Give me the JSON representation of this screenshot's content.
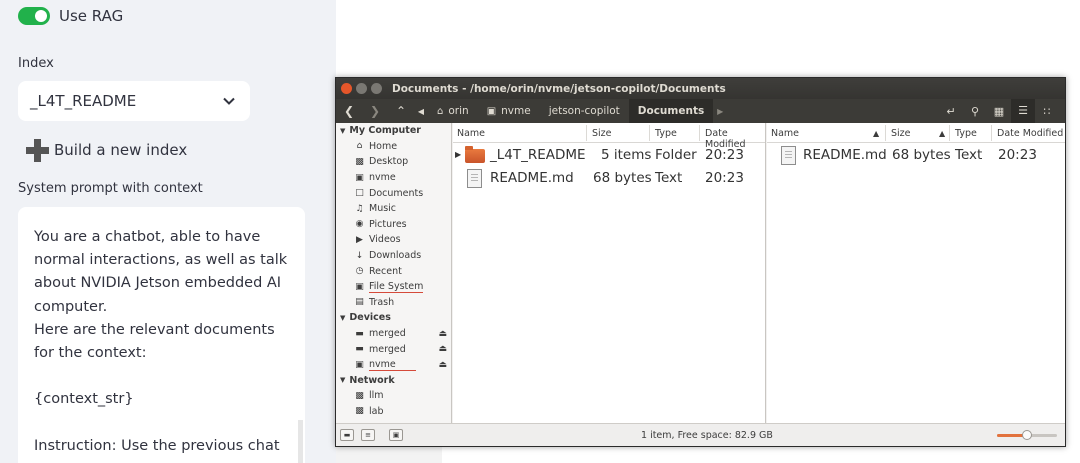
{
  "sidebar": {
    "rag_toggle": {
      "label": "Use RAG",
      "on": true
    },
    "index_label": "Index",
    "index_value": "_L4T_README",
    "build_button": "Build a new index",
    "system_prompt_label": "System prompt with context",
    "system_prompt_text": "You are a chatbot, able to have normal interactions, as well as talk about NVIDIA Jetson embedded AI computer.\nHere are the relevant documents for the context:\n\n{context_str}\n\nInstruction: Use the previous chat"
  },
  "window": {
    "title": "Documents - /home/orin/nvme/jetson-copilot/Documents",
    "breadcrumbs": [
      "orin",
      "nvme",
      "jetson-copilot",
      "Documents"
    ],
    "places": {
      "my_computer": "My Computer",
      "my_computer_items": [
        {
          "label": "Home",
          "icon": "home-icon"
        },
        {
          "label": "Desktop",
          "icon": "desktop-icon"
        },
        {
          "label": "nvme",
          "icon": "drive-icon"
        },
        {
          "label": "Documents",
          "icon": "documents-icon"
        },
        {
          "label": "Music",
          "icon": "music-icon"
        },
        {
          "label": "Pictures",
          "icon": "pictures-icon"
        },
        {
          "label": "Videos",
          "icon": "videos-icon"
        },
        {
          "label": "Downloads",
          "icon": "downloads-icon"
        },
        {
          "label": "Recent",
          "icon": "recent-icon"
        },
        {
          "label": "File System",
          "icon": "filesystem-icon"
        },
        {
          "label": "Trash",
          "icon": "trash-icon"
        }
      ],
      "devices": "Devices",
      "devices_items": [
        {
          "label": "merged",
          "icon": "drive-icon"
        },
        {
          "label": "merged",
          "icon": "drive-icon"
        },
        {
          "label": "nvme",
          "icon": "drive-icon"
        }
      ],
      "network": "Network",
      "network_items": [
        {
          "label": "llm",
          "icon": "network-icon"
        },
        {
          "label": "lab",
          "icon": "network-icon"
        }
      ]
    },
    "columns": {
      "name": "Name",
      "size": "Size",
      "type": "Type",
      "date": "Date Modified"
    },
    "right_columns": {
      "date": "Date Modified"
    },
    "left_files": [
      {
        "name": "_L4T_README",
        "size": "5 items",
        "type": "Folder",
        "date": "20:23",
        "icon": "folder-icon"
      },
      {
        "name": "README.md",
        "size": "68 bytes",
        "type": "Text",
        "date": "20:23",
        "icon": "text-file-icon"
      }
    ],
    "right_files": [
      {
        "name": "README.md",
        "size": "68 bytes",
        "type": "Text",
        "date": "20:23",
        "icon": "text-file-icon"
      }
    ],
    "status": "1 item, Free space: 82.9 GB",
    "zoom_level": 0.5
  }
}
